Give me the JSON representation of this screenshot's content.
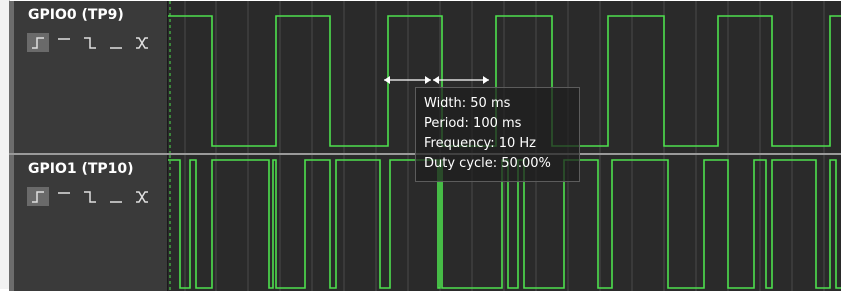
{
  "channels": [
    {
      "name": "GPIO0 (TP9)",
      "trigger_icons": [
        "rising-edge-icon",
        "high-level-icon",
        "falling-edge-icon",
        "low-level-icon",
        "either-edge-icon"
      ],
      "active_trigger": "rising-edge-icon"
    },
    {
      "name": "GPIO1 (TP10)",
      "trigger_icons": [
        "rising-edge-icon",
        "high-level-icon",
        "falling-edge-icon",
        "low-level-icon",
        "either-edge-icon"
      ],
      "active_trigger": "rising-edge-icon"
    }
  ],
  "measurement": {
    "width": "Width: 50 ms",
    "period": "Period: 100 ms",
    "frequency": "Frequency: 10 Hz",
    "duty_cycle": "Duty cycle: 50.00%"
  },
  "colors": {
    "signal": "#4ee04e",
    "background": "#2a2a2a",
    "grid": "#555555",
    "sidebar": "#3a3a3a"
  }
}
